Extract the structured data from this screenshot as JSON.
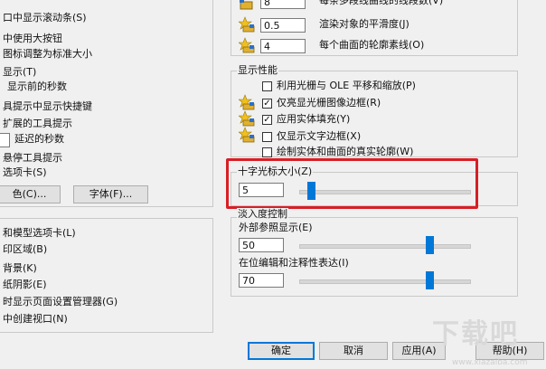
{
  "left_panel": {
    "items": [
      "口中显示滚动条(S)",
      "中使用大按钮",
      "图标调整为标准大小",
      "显示(T)",
      "显示前的秒数",
      "具提示中显示快捷键",
      "扩展的工具提示",
      "延迟的秒数",
      "悬停工具提示",
      "选项卡(S)"
    ],
    "color_button": "色(C)...",
    "font_button": "字体(F)...",
    "layout_items": [
      "和模型选项卡(L)",
      "印区域(B)",
      "背景(K)",
      "纸阴影(E)",
      "时显示页面设置管理器(G)",
      "中创建视口(N)"
    ]
  },
  "resolution": {
    "top_partial_label": "每条多段线曲线的线段数(V)",
    "top_partial_value": "8",
    "smoothness_label": "渲染对象的平滑度(J)",
    "smoothness_value": "0.5",
    "contour_label": "每个曲面的轮廓素线(O)",
    "contour_value": "4"
  },
  "display_performance": {
    "title": "显示性能",
    "options": [
      {
        "label": "利用光栅与 OLE 平移和缩放(P)",
        "checked": false
      },
      {
        "label": "仅亮显光栅图像边框(R)",
        "checked": true
      },
      {
        "label": "应用实体填充(Y)",
        "checked": true
      },
      {
        "label": "仅显示文字边框(X)",
        "checked": false
      },
      {
        "label": "绘制实体和曲面的真实轮廓(W)",
        "checked": false
      }
    ]
  },
  "crosshair": {
    "title": "十字光标大小(Z)",
    "value": "5",
    "slider_percent": 5
  },
  "fade_control": {
    "title": "淡入度控制",
    "xref_label": "外部参照显示(E)",
    "xref_value": "50",
    "xref_percent": 50,
    "inplace_label": "在位编辑和注释性表达(I)",
    "inplace_value": "70",
    "inplace_percent": 70
  },
  "footer": {
    "ok": "确定",
    "cancel": "取消",
    "apply": "应用(A)",
    "help": "帮助(H)"
  },
  "watermark": {
    "text": "下载吧",
    "url": "www.xiazaiba.com"
  }
}
